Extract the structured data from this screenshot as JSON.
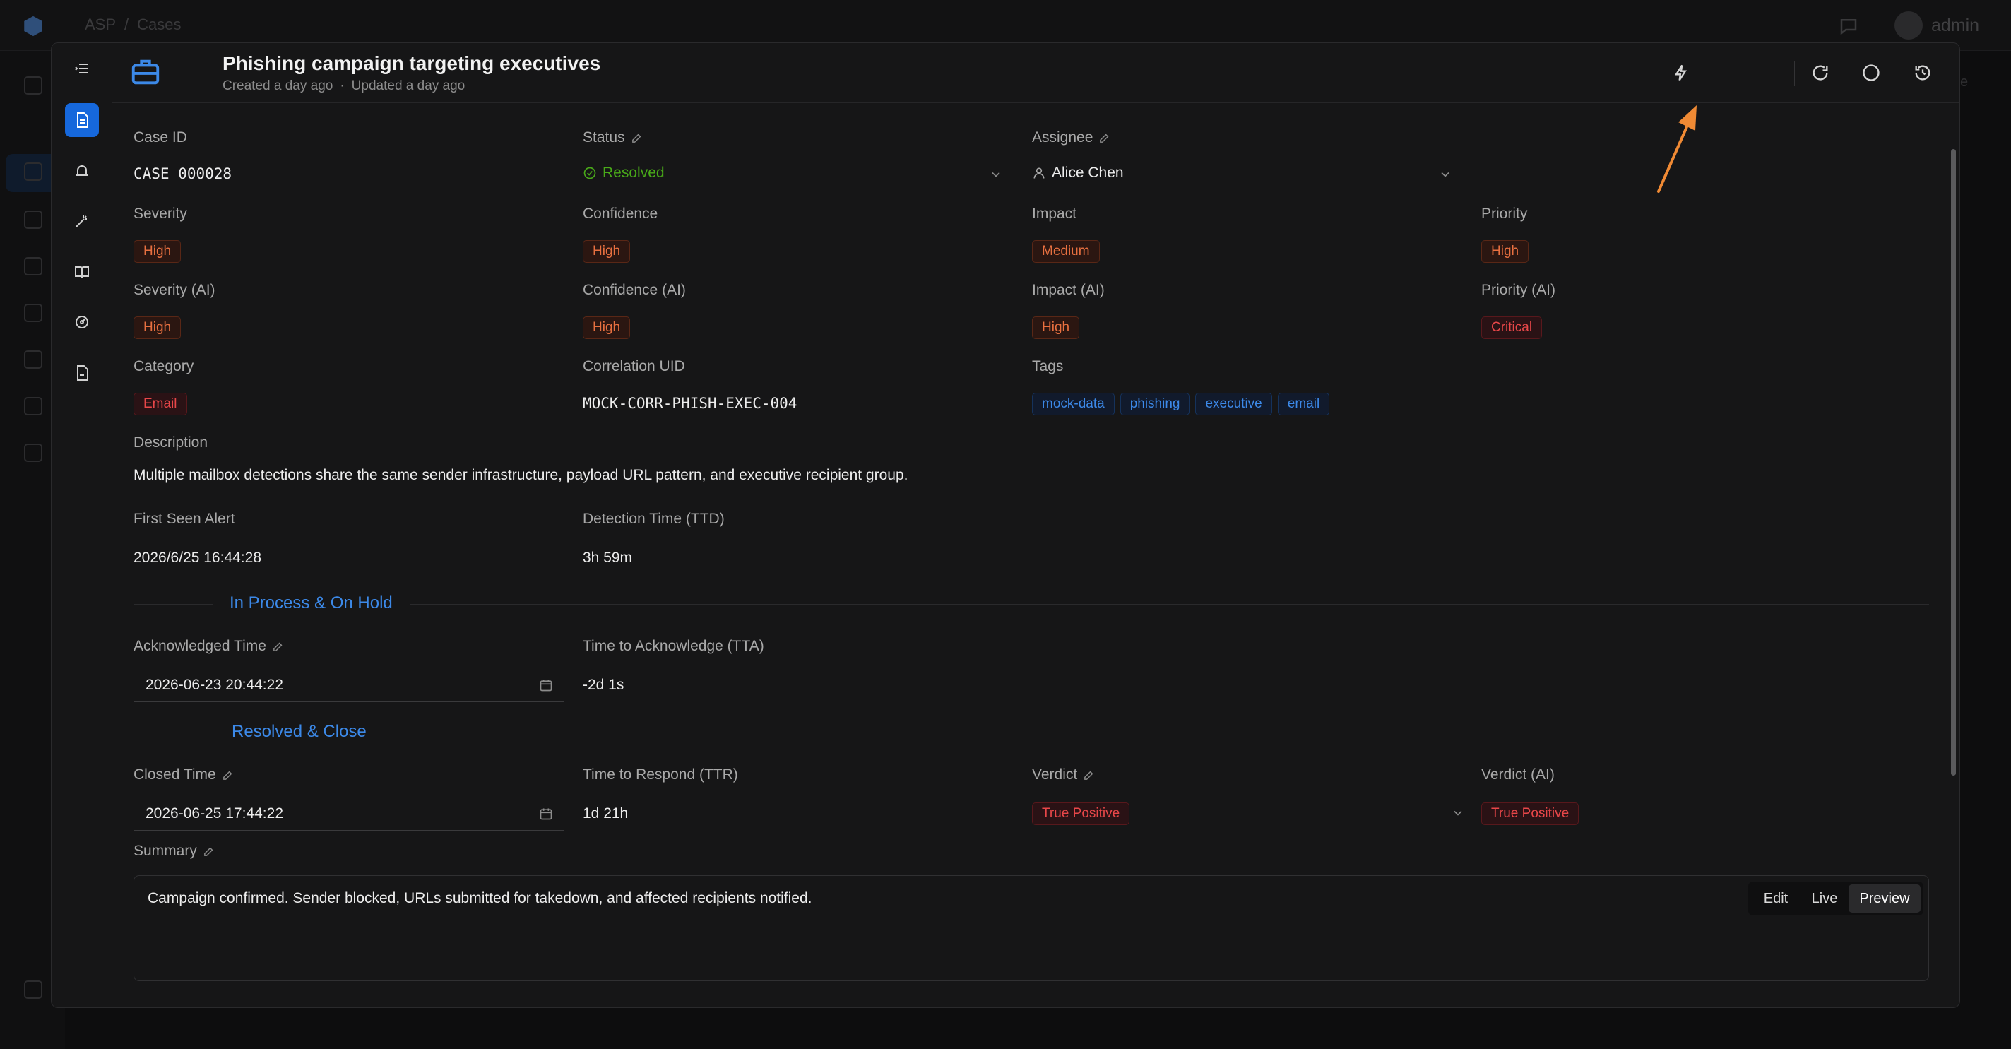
{
  "app": {
    "breadcrumb": [
      "ASP",
      "Cases"
    ],
    "breadcrumb_sep": "/",
    "user": "admin",
    "bg_fragment": "e"
  },
  "case": {
    "title": "Phishing campaign targeting executives",
    "created": "Created a day ago",
    "updated": "Updated a day ago",
    "meta_sep": "·"
  },
  "fields": {
    "case_id": {
      "label": "Case ID",
      "value": "CASE_000028"
    },
    "status": {
      "label": "Status",
      "value": "Resolved"
    },
    "assignee": {
      "label": "Assignee",
      "value": "Alice Chen"
    },
    "severity": {
      "label": "Severity",
      "value": "High"
    },
    "confidence": {
      "label": "Confidence",
      "value": "High"
    },
    "impact": {
      "label": "Impact",
      "value": "Medium"
    },
    "priority": {
      "label": "Priority",
      "value": "High"
    },
    "severity_ai": {
      "label": "Severity (AI)",
      "value": "High"
    },
    "confidence_ai": {
      "label": "Confidence (AI)",
      "value": "High"
    },
    "impact_ai": {
      "label": "Impact (AI)",
      "value": "High"
    },
    "priority_ai": {
      "label": "Priority (AI)",
      "value": "Critical"
    },
    "category": {
      "label": "Category",
      "value": "Email"
    },
    "correlation_uid": {
      "label": "Correlation UID",
      "value": "MOCK-CORR-PHISH-EXEC-004"
    },
    "tags": {
      "label": "Tags",
      "values": [
        "mock-data",
        "phishing",
        "executive",
        "email"
      ]
    },
    "description": {
      "label": "Description",
      "value": "Multiple mailbox detections share the same sender infrastructure, payload URL pattern, and executive recipient group."
    },
    "first_seen": {
      "label": "First Seen Alert",
      "value": "2026/6/25 16:44:28"
    },
    "ttd": {
      "label": "Detection Time (TTD)",
      "value": "3h 59m"
    },
    "acknowledged_time": {
      "label": "Acknowledged Time",
      "value": "2026-06-23 20:44:22"
    },
    "tta": {
      "label": "Time to Acknowledge (TTA)",
      "value": "-2d 1s"
    },
    "closed_time": {
      "label": "Closed Time",
      "value": "2026-06-25 17:44:22"
    },
    "ttr": {
      "label": "Time to Respond (TTR)",
      "value": "1d 21h"
    },
    "verdict": {
      "label": "Verdict",
      "value": "True Positive"
    },
    "verdict_ai": {
      "label": "Verdict (AI)",
      "value": "True Positive"
    },
    "summary": {
      "label": "Summary",
      "value": "Campaign confirmed. Sender blocked, URLs submitted for takedown, and affected recipients notified."
    }
  },
  "sections": {
    "in_process": "In Process & On Hold",
    "resolved": "Resolved & Close"
  },
  "summary_modes": {
    "edit": "Edit",
    "live": "Live",
    "preview": "Preview",
    "selected": "Preview"
  },
  "colors": {
    "accent": "#1668dc",
    "tag_red": "#e84749",
    "tag_orange": "#e87040",
    "tag_blue": "#3c89e8",
    "status_green": "#49aa19",
    "annotation_arrow": "#f08a34"
  }
}
